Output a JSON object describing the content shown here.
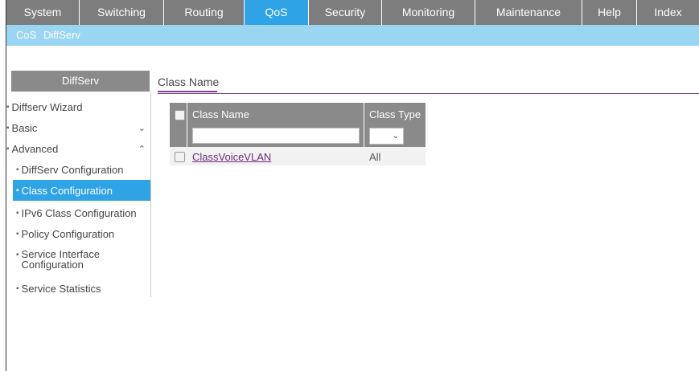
{
  "topnav": {
    "tabs": [
      {
        "label": "System",
        "active": false
      },
      {
        "label": "Switching",
        "active": false
      },
      {
        "label": "Routing",
        "active": false
      },
      {
        "label": "QoS",
        "active": true
      },
      {
        "label": "Security",
        "active": false
      },
      {
        "label": "Monitoring",
        "active": false
      },
      {
        "label": "Maintenance",
        "active": false
      },
      {
        "label": "Help",
        "active": false
      },
      {
        "label": "Index",
        "active": false
      }
    ]
  },
  "subnav": {
    "cos": "CoS",
    "diffserv": "DiffServ"
  },
  "sidebar": {
    "title": "DiffServ",
    "items": [
      {
        "label": "Diffserv Wizard",
        "level": 1
      },
      {
        "label": "Basic",
        "level": 1,
        "chevron": "chevron-down-icon"
      },
      {
        "label": "Advanced",
        "level": 1,
        "chevron": "chevron-up-icon"
      },
      {
        "label": "DiffServ Configuration",
        "level": 2
      },
      {
        "label": "Class Configuration",
        "level": 2,
        "active": true
      },
      {
        "label": "IPv6 Class Configuration",
        "level": 2
      },
      {
        "label": "Policy Configuration",
        "level": 2
      },
      {
        "label": "Service Interface Configuration",
        "level": 2
      },
      {
        "label": "Service Statistics",
        "level": 2
      }
    ]
  },
  "content": {
    "tab": "Class Name",
    "table": {
      "headers": [
        "Class Name",
        "Class Type"
      ],
      "filter": {
        "class_name": "",
        "class_type": ""
      },
      "rows": [
        {
          "class_name": "ClassVoiceVLAN",
          "class_type": "All"
        }
      ]
    }
  },
  "colors": {
    "accent": "#2ea3e6",
    "subnav": "#9ad5f1",
    "header": "#8a8a8a",
    "link": "#6a2c7e"
  }
}
